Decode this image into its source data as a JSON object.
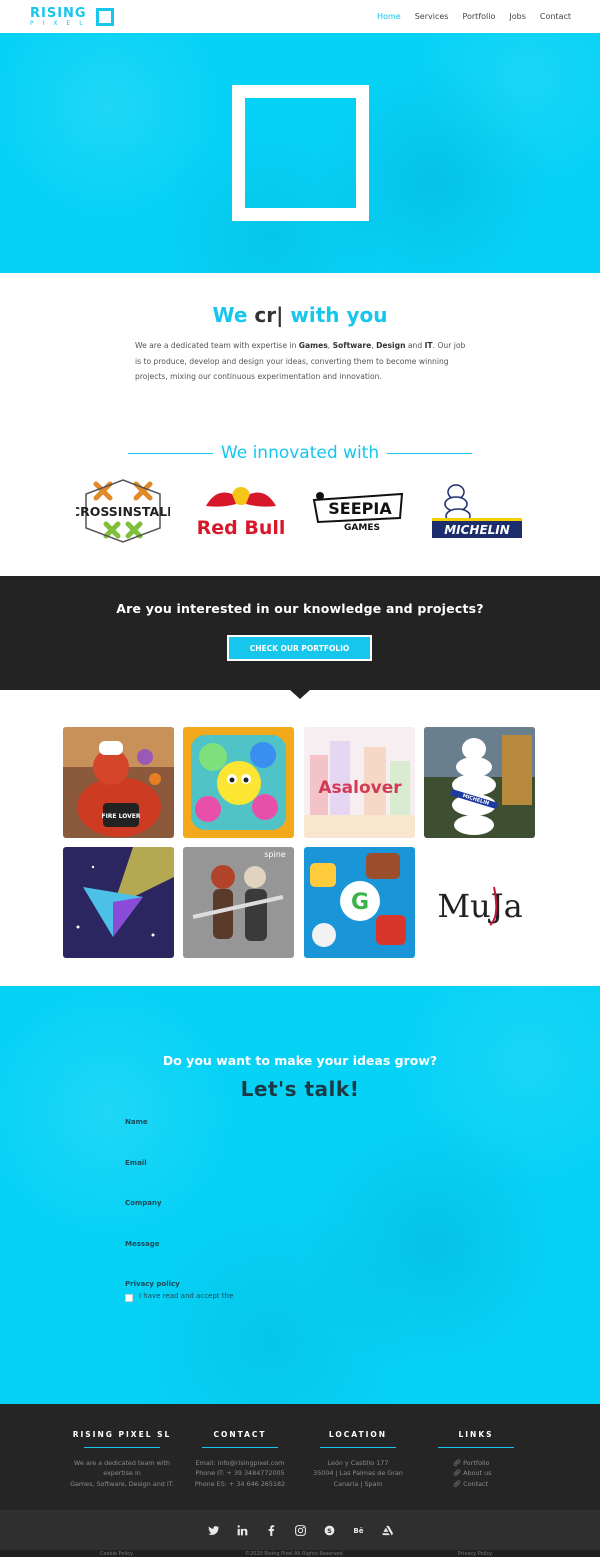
{
  "header": {
    "logo_top": "RISING",
    "logo_bottom": "PIXEL",
    "nav": [
      {
        "label": "Home",
        "active": true
      },
      {
        "label": "Services",
        "active": false
      },
      {
        "label": "Portfolio",
        "active": false
      },
      {
        "label": "Jobs",
        "active": false
      },
      {
        "label": "Contact",
        "active": false
      }
    ]
  },
  "about": {
    "title_start": "We ",
    "title_typed": "cr|",
    "title_end": " with you",
    "text_1": "We are a dedicated team with expertise in ",
    "bold_games": "Games",
    "sep_1": ", ",
    "bold_software": "Software",
    "sep_2": ", ",
    "bold_design": "Design",
    "sep_3": " and ",
    "bold_it": "IT",
    "text_2": ". Our job is to produce, develop and design your ideas, converting them to become winning projects, mixing our continuous experimentation and innovation."
  },
  "innovated": {
    "title": "We innovated with",
    "clients": [
      {
        "name": "CROSSINSTALL"
      },
      {
        "name": "Red Bull"
      },
      {
        "name": "SEEPIA",
        "sub": "GAMES"
      },
      {
        "name": "MICHELIN"
      }
    ]
  },
  "cta": {
    "title": "Are you interested in our knowledge and projects?",
    "button": "CHECK OUR PORTFOLIO"
  },
  "portfolio": {
    "tiles": [
      {
        "icon": "chef-dragon-game",
        "caption": "FIRE LOVER"
      },
      {
        "icon": "puzzle-characters-game",
        "caption": ""
      },
      {
        "icon": "asalover-game",
        "caption": "Asalover"
      },
      {
        "icon": "michelin-man",
        "caption": "MICHELIN"
      },
      {
        "icon": "spaceship-game",
        "caption": ""
      },
      {
        "icon": "warriors-spine",
        "caption": "spine"
      },
      {
        "icon": "cartoon-characters-game",
        "caption": ""
      },
      {
        "icon": "muja-logo",
        "caption": "MuJa"
      }
    ]
  },
  "contact": {
    "question": "Do you want to make your ideas grow?",
    "cta": "Let's talk!",
    "fields": {
      "name": "Name",
      "email": "Email",
      "company": "Company",
      "message": "Message",
      "privacy": "Privacy policy"
    },
    "checkbox_text": "I have read and accept the"
  },
  "footer": {
    "company": {
      "title": "RISING PIXEL SL",
      "line1": "We are a dedicated team with",
      "line2": "expertise in",
      "line3": "Games, Software, Design and IT."
    },
    "contact": {
      "title": "CONTACT",
      "email": "Email: info@risingpixel.com",
      "phone_it": "Phone IT: + 39 3484772005",
      "phone_es": "Phone ES: + 34 646 265182"
    },
    "location": {
      "title": "LOCATION",
      "line1": "León y Castillo 177",
      "line2": "35004 | Las Palmas de Gran",
      "line3": "Canaria | Spain"
    },
    "links": {
      "title": "LINKS",
      "items": [
        "Portfolio",
        "About us",
        "Contact"
      ]
    },
    "social": [
      "twitter-icon",
      "linkedin-icon",
      "facebook-icon",
      "instagram-icon",
      "skype-icon",
      "behance-icon",
      "artstation-icon"
    ],
    "bottom": {
      "cookie": "Cookie Policy",
      "copyright": "©2020 Rising Pixel All Rights Reserved",
      "privacy": "Privacy Policy"
    }
  },
  "colors": {
    "accent": "#16c6ec",
    "hero": "#06d2f6",
    "dark": "#232323"
  }
}
